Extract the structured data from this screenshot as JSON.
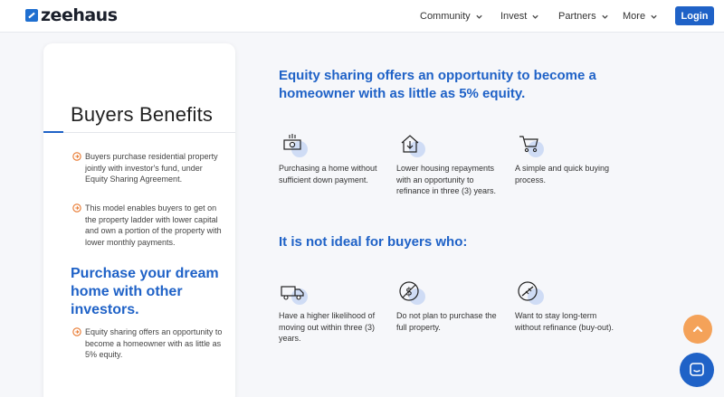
{
  "brand": {
    "name": "zeehaus",
    "accent": "#1f62c7"
  },
  "nav": {
    "items": [
      {
        "label": "Community",
        "icon": "chevron-down-icon"
      },
      {
        "label": "Invest",
        "icon": "chevron-down-icon"
      },
      {
        "label": "Partners",
        "icon": "chevron-down-icon"
      },
      {
        "label": "More",
        "icon": "chevron-down-icon"
      }
    ],
    "login_label": "Login"
  },
  "sidebar": {
    "title": "Buyers Benefits",
    "bullets": [
      "Buyers purchase residential property jointly with investor's fund, under Equity Sharing Agreement.",
      "This model enables buyers to get on the property ladder with lower capital and own a portion of the property with lower monthly payments."
    ],
    "subheading": "Purchase your dream home with other investors.",
    "bullets2": [
      "Equity sharing offers an opportunity to become a homeowner with as little as 5% equity."
    ]
  },
  "main": {
    "heading": "Equity sharing offers an opportunity to become a homeowner with as little as 5% equity.",
    "benefits": [
      {
        "icon": "money-icon",
        "text": "Purchasing a home without sufficient down payment."
      },
      {
        "icon": "house-down-icon",
        "text": "Lower housing repayments with an opportunity to refinance in three (3) years."
      },
      {
        "icon": "cart-icon",
        "text": "A simple and quick buying process."
      }
    ],
    "not_ideal_heading": "It is not ideal for buyers who:",
    "not_ideal": [
      {
        "icon": "truck-icon",
        "text": "Have a higher likelihood of moving out within three (3) years."
      },
      {
        "icon": "no-dollar-icon",
        "text": "Do not plan to purchase the full property."
      },
      {
        "icon": "no-refinance-icon",
        "text": "Want to stay long-term without refinance (buy-out)."
      }
    ]
  },
  "floating": {
    "scroll_up_icon": "chevron-up-icon",
    "chat_icon": "chat-icon"
  }
}
